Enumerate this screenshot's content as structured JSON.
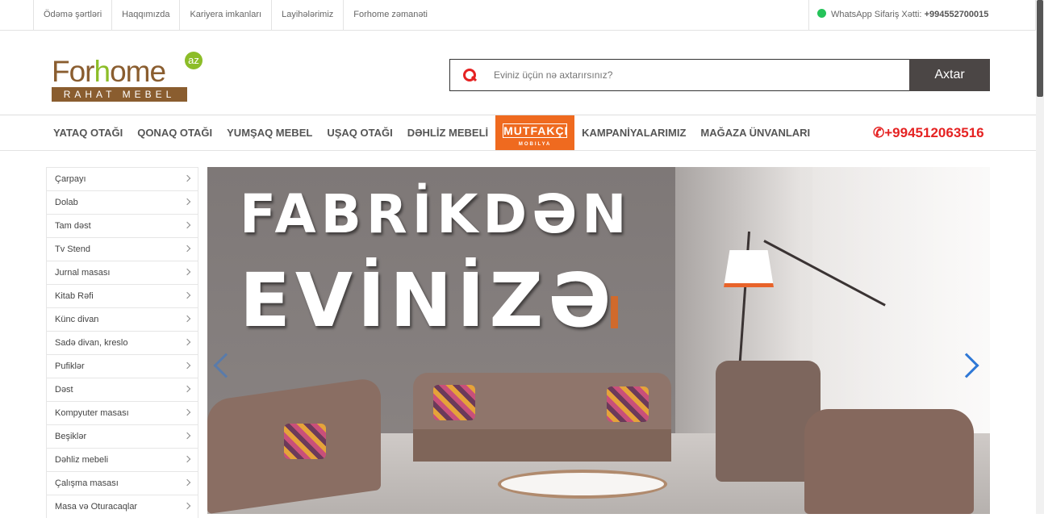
{
  "topbar": {
    "links": [
      "Ödəmə şərtləri",
      "Haqqımızda",
      "Kariyera imkanları",
      "Layihələrimiz",
      "Forhome zəmanəti"
    ],
    "whatsapp_label": "WhatsApp Sifariş Xətti:",
    "whatsapp_phone": "+994552700015"
  },
  "logo": {
    "word_a": "For",
    "word_b": "h",
    "word_c": "ome",
    "badge": "az",
    "tagline": "RAHAT MEBEL"
  },
  "search": {
    "placeholder": "Eviniz üçün nə axtarırsınız?",
    "button": "Axtar"
  },
  "nav": {
    "items": [
      "YATAQ OTAĞI",
      "QONAQ OTAĞI",
      "YUMŞAQ MEBEL",
      "UŞAQ OTAĞI",
      "DƏHLİZ MEBELİ"
    ],
    "mutfak_logo": "MUTFAKÇI",
    "mutfak_sub": "MOBILYA",
    "items2": [
      "KAMPANİYALARIMIZ",
      "MAĞAZA ÜNVANLARI"
    ],
    "phone": "+994512063516"
  },
  "sidebar": {
    "items": [
      "Çarpayı",
      "Dolab",
      "Tam dəst",
      "Tv Stend",
      "Jurnal masası",
      "Kitab Rəfi",
      "Künc divan",
      "Sadə divan, kreslo",
      "Pufiklər",
      "Dəst",
      "Kompyuter masası",
      "Beşiklər",
      "Dəhliz mebeli",
      "Çalışma masası",
      "Masa və Oturacaqlar"
    ]
  },
  "banner": {
    "line1": "FABRİKDƏN",
    "line2": "EVİNİZƏ"
  },
  "colors": {
    "accent": "#e52222",
    "brand_brown": "#8a5d2f",
    "brand_green": "#8cbd28",
    "mutfak_orange": "#ef6a1f",
    "search_btn": "#4b4645"
  },
  "icons": {
    "whatsapp": "whatsapp-icon",
    "search": "search-icon",
    "phone": "phone-icon",
    "chevron": "chevron-right-icon"
  }
}
